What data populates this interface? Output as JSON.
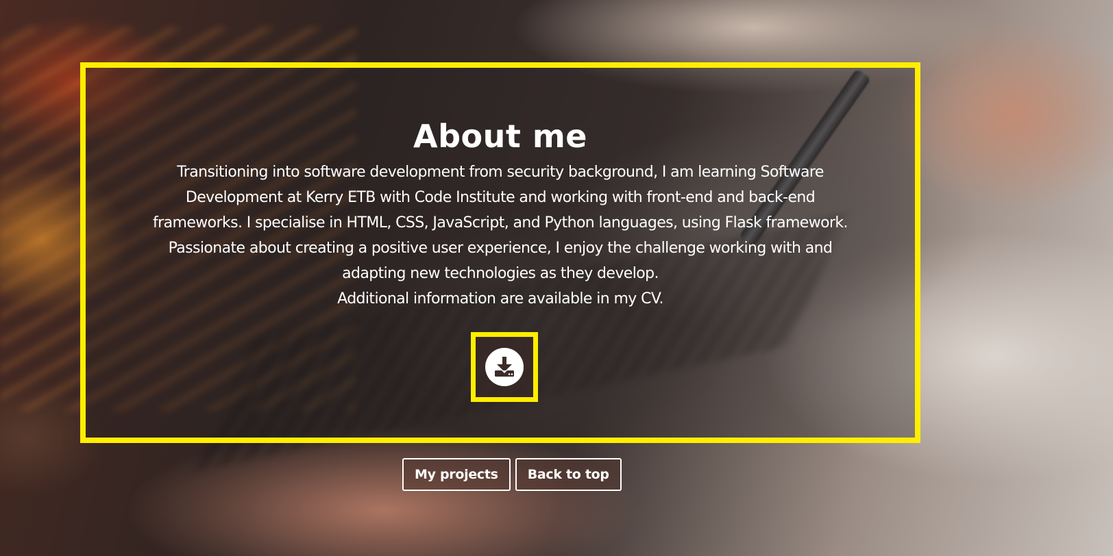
{
  "about": {
    "title": "About me",
    "paragraph_lines": [
      "Transitioning into software development from security background, I am learning Software",
      "Development at Kerry ETB with Code Institute and working with front-end and back-end",
      "frameworks. I specialise in HTML, CSS, JavaScript, and Python languages, using Flask framework.",
      "Passionate about creating a positive user experience, I enjoy the challenge working with and",
      "adapting new technologies as they develop.",
      "Additional information are available in my CV."
    ],
    "download_icon": "download-icon",
    "accent_color": "#ffee00"
  },
  "nav": {
    "projects_label": "My projects",
    "top_label": "Back to top"
  }
}
